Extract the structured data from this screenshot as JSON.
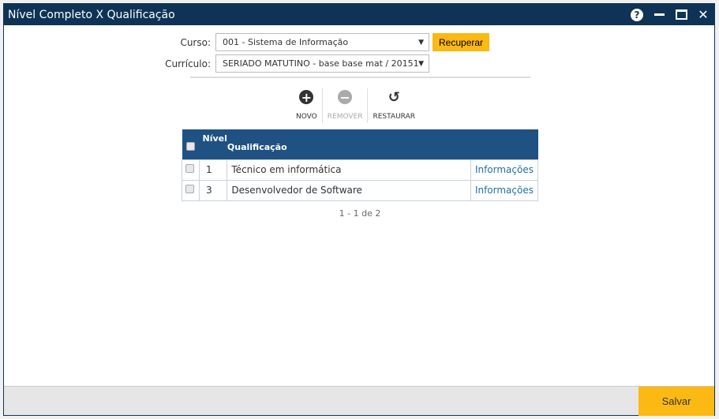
{
  "title": "Nível Completo X Qualificação",
  "form": {
    "curso_label": "Curso:",
    "curso_value": "001 - Sistema de Informação",
    "recuperar": "Recuperar",
    "curriculo_label": "Currículo:",
    "curriculo_value": "SERIADO MATUTINO - base base mat / 20151"
  },
  "toolbar": {
    "novo": "NOVO",
    "remover": "REMOVER",
    "restaurar": "RESTAURAR"
  },
  "table": {
    "headers": {
      "nivel": "Nível",
      "qualificacao": "Qualificação"
    },
    "rows": [
      {
        "nivel": "1",
        "qualificacao": "Técnico em informática",
        "link": "Informações"
      },
      {
        "nivel": "3",
        "qualificacao": "Desenvolvedor de Software",
        "link": "Informações"
      }
    ]
  },
  "pagination": "1 - 1 de 2",
  "footer": {
    "save": "Salvar"
  },
  "colors": {
    "titlebar": "#0e3356",
    "header": "#1f5183",
    "accent": "#fdb913"
  }
}
